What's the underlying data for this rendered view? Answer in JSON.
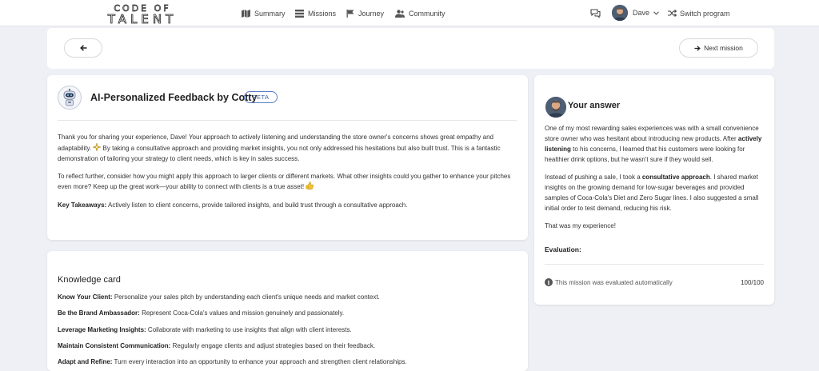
{
  "brand": {
    "line1": "CODE OF",
    "line2": "TALENT"
  },
  "nav": {
    "summary": "Summary",
    "missions": "Missions",
    "journey": "Journey",
    "community": "Community",
    "user_name": "Dave",
    "switch_program": "Switch program"
  },
  "actions": {
    "next_mission": "Next mission"
  },
  "feedback": {
    "title": "AI-Personalized Feedback by Cotty",
    "badge": "BETA",
    "p1a": "Thank you for sharing your experience, Dave! Your approach to actively listening and understanding the store owner's concerns shows great empathy and adaptability. ",
    "p1b": " By taking a consultative approach and providing market insights, you not only addressed his hesitations but also built trust. This is a fantastic demonstration of tailoring your strategy to client needs, which is key in sales success.",
    "p2": "To reflect further, consider how you might apply this approach to larger clients or different markets. What other insights could you gather to enhance your pitches even more? Keep up the great work—your ability to connect with clients is a true asset! ",
    "takeaways_label": "Key Takeaways:",
    "takeaways_text": " Actively listen to client concerns, provide tailored insights, and build trust through a consultative approach."
  },
  "answer": {
    "title": "Your answer",
    "p1a": "One of my most rewarding sales experiences was with a small convenience store owner who was hesitant about introducing new products. After ",
    "p1b": "actively listening",
    "p1c": " to his concerns, I learned that his customers were looking for healthier drink options, but he wasn't sure if they would sell.",
    "p2a": "Instead of pushing a sale, I took a ",
    "p2b": "consultative approach",
    "p2c": ". I shared market insights on the growing demand for low-sugar beverages and provided samples of Coca-Cola's Diet and Zero Sugar lines. I also suggested a small initial order to test demand, reducing his risk.",
    "p3": "That was my experience!",
    "evaluation_label": "Evaluation:",
    "auto_eval": "This mission was evaluated automatically",
    "score": "100/100"
  },
  "knowledge": {
    "title": "Knowledge card",
    "items": [
      {
        "label": "Know Your Client:",
        "text": " Personalize your sales pitch by understanding each client's unique needs and market context."
      },
      {
        "label": "Be the Brand Ambassador:",
        "text": " Represent Coca-Cola's values and mission genuinely and passionately."
      },
      {
        "label": "Leverage Marketing Insights:",
        "text": " Collaborate with marketing to use insights that align with client interests."
      },
      {
        "label": "Maintain Consistent Communication:",
        "text": " Regularly engage clients and adjust strategies based on their feedback."
      },
      {
        "label": "Adapt and Refine:",
        "text": " Turn every interaction into an opportunity to enhance your approach and strengthen client relationships."
      }
    ]
  },
  "colors": {
    "accent": "#3f63a8",
    "background": "#eff0f5",
    "card": "#ffffff"
  },
  "icons": [
    "map-icon",
    "list-icon",
    "flag-icon",
    "community-icon",
    "chat-icon",
    "chevron-down-icon",
    "shuffle-icon",
    "arrow-left-icon",
    "arrow-right-icon",
    "robot-icon",
    "sparkle-icon",
    "thumbs-up-icon",
    "info-icon"
  ]
}
